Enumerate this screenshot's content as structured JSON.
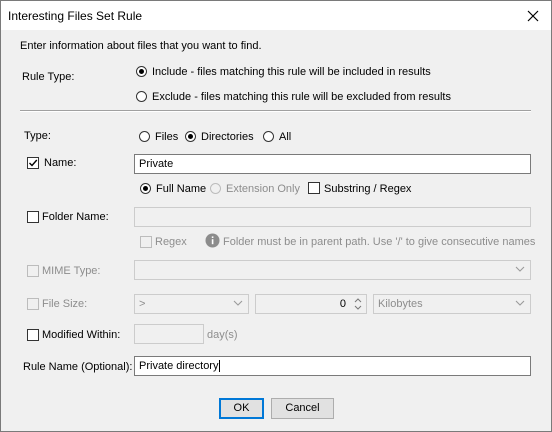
{
  "window": {
    "title": "Interesting Files Set Rule"
  },
  "intro": "Enter information about files that you want to find.",
  "rule_type": {
    "label": "Rule Type:",
    "include": "Include - files matching this rule will be included in results",
    "exclude": "Exclude - files matching this rule will be excluded from results",
    "selected": "include"
  },
  "type": {
    "label": "Type:",
    "options": [
      "Files",
      "Directories",
      "All"
    ],
    "selected": "Directories"
  },
  "name": {
    "label": "Name:",
    "checked": true,
    "value": "Private",
    "full_name": "Full Name",
    "extension_only": "Extension Only",
    "substring_regex": "Substring / Regex"
  },
  "folder": {
    "label": "Folder Name:",
    "value": "",
    "regex": "Regex",
    "hint": "Folder must be in parent path. Use '/' to give consecutive names"
  },
  "mime": {
    "label": "MIME Type:",
    "value": ""
  },
  "file_size": {
    "label": "File Size:",
    "operator": ">",
    "amount": "0",
    "unit": "Kilobytes"
  },
  "modified": {
    "label": "Modified Within:",
    "value": "",
    "unit": "day(s)"
  },
  "rule_name": {
    "label": "Rule Name (Optional):",
    "value": "Private directory"
  },
  "buttons": {
    "ok": "OK",
    "cancel": "Cancel"
  }
}
